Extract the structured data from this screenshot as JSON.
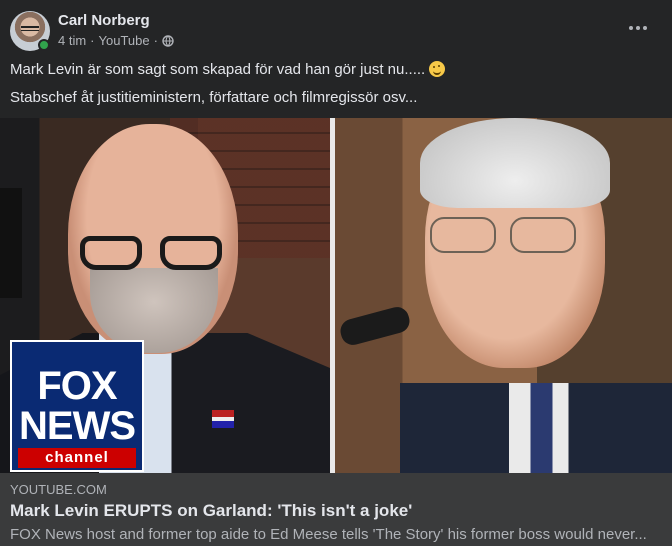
{
  "post": {
    "author": "Carl Norberg",
    "time": "4 tim",
    "source": "YouTube",
    "separator": "·",
    "privacy_icon": "globe-icon",
    "more_icon": "more-horizontal-icon",
    "text_line1": "Mark Levin är som sagt som skapad för vad han gör just nu.....",
    "emoji": "winking-face-emoji",
    "text_line2": "Stabschef åt justitieministern, författare och filmregissör osv..."
  },
  "media": {
    "logo_line1": "FOX",
    "logo_line2": "NEWS",
    "logo_channel": "channel"
  },
  "link": {
    "domain": "YOUTUBE.COM",
    "title": "Mark Levin ERUPTS on Garland: 'This isn't a joke'",
    "description": "FOX News host and former top aide to Ed Meese tells 'The Story' his former boss would never..."
  },
  "colors": {
    "background": "#242526",
    "card": "#3a3b3c",
    "primary_text": "#e4e6eb",
    "secondary_text": "#b0b3b8",
    "online": "#31a24c",
    "fox_blue": "#0a2a73",
    "fox_red": "#cc0000"
  }
}
